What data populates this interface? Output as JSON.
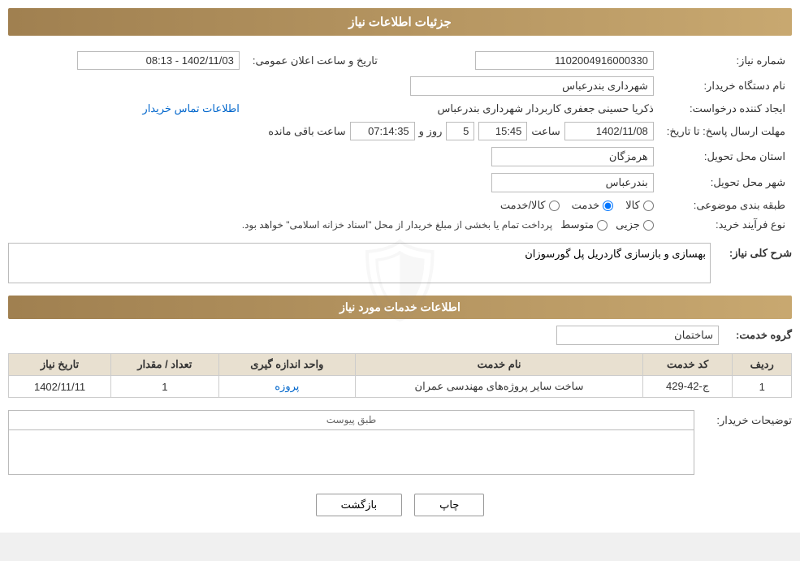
{
  "header": {
    "title": "جزئیات اطلاعات نیاز"
  },
  "form": {
    "shomara_niaz_label": "شماره نیاز:",
    "shomara_niaz_value": "1102004916000330",
    "tarikh_label": "تاریخ و ساعت اعلان عمومی:",
    "tarikh_value": "1402/11/03 - 08:13",
    "nam_dastgah_label": "نام دستگاه خریدار:",
    "nam_dastgah_value": "شهرداری بندرعباس",
    "ijad_label": "ایجاد کننده درخواست:",
    "ijad_value": "ذکریا حسینی جعفری کاربردار شهرداری بندرعباس",
    "ijad_link": "اطلاعات تماس خریدار",
    "mohlet_label": "مهلت ارسال پاسخ: تا تاریخ:",
    "mohlet_date": "1402/11/08",
    "mohlet_saat_label": "ساعت",
    "mohlet_saat": "15:45",
    "mohlet_rooz_label": "روز و",
    "mohlet_rooz": "5",
    "mohlet_baqi_label": "ساعت باقی مانده",
    "mohlet_baqi": "07:14:35",
    "ostan_label": "استان محل تحویل:",
    "ostan_value": "هرمزگان",
    "shahr_label": "شهر محل تحویل:",
    "shahr_value": "بندرعباس",
    "tabaqe_label": "طبقه بندی موضوعی:",
    "tabaqe_options": [
      "کالا",
      "خدمت",
      "کالا/خدمت"
    ],
    "tabaqe_selected": "خدمت",
    "nooe_farayand_label": "نوع فرآیند خرید:",
    "nooe_farayand_options": [
      "جزیی",
      "متوسط"
    ],
    "nooe_farayand_note": "پرداخت تمام یا بخشی از مبلغ خریدار از محل \"اسناد خزانه اسلامی\" خواهد بود.",
    "sharh_label": "شرح کلی نیاز:",
    "sharh_value": "بهسازی و بازسازی گاردریل پل گورسوزان",
    "services_header": "اطلاعات خدمات مورد نیاز",
    "group_label": "گروه خدمت:",
    "group_value": "ساختمان",
    "table": {
      "columns": [
        "ردیف",
        "کد خدمت",
        "نام خدمت",
        "واحد اندازه گیری",
        "تعداد / مقدار",
        "تاریخ نیاز"
      ],
      "rows": [
        {
          "radif": "1",
          "kod": "ج-42-429",
          "nam": "ساخت سایر پروژه‌های مهندسی عمران",
          "vahed": "پروزه",
          "tedad": "1",
          "tarikh": "1402/11/11"
        }
      ]
    },
    "tavzihat_label": "توضیحات خریدار:",
    "tavzihat_placeholder": "طبق پیوست",
    "btn_chap": "چاپ",
    "btn_bazgasht": "بازگشت"
  }
}
